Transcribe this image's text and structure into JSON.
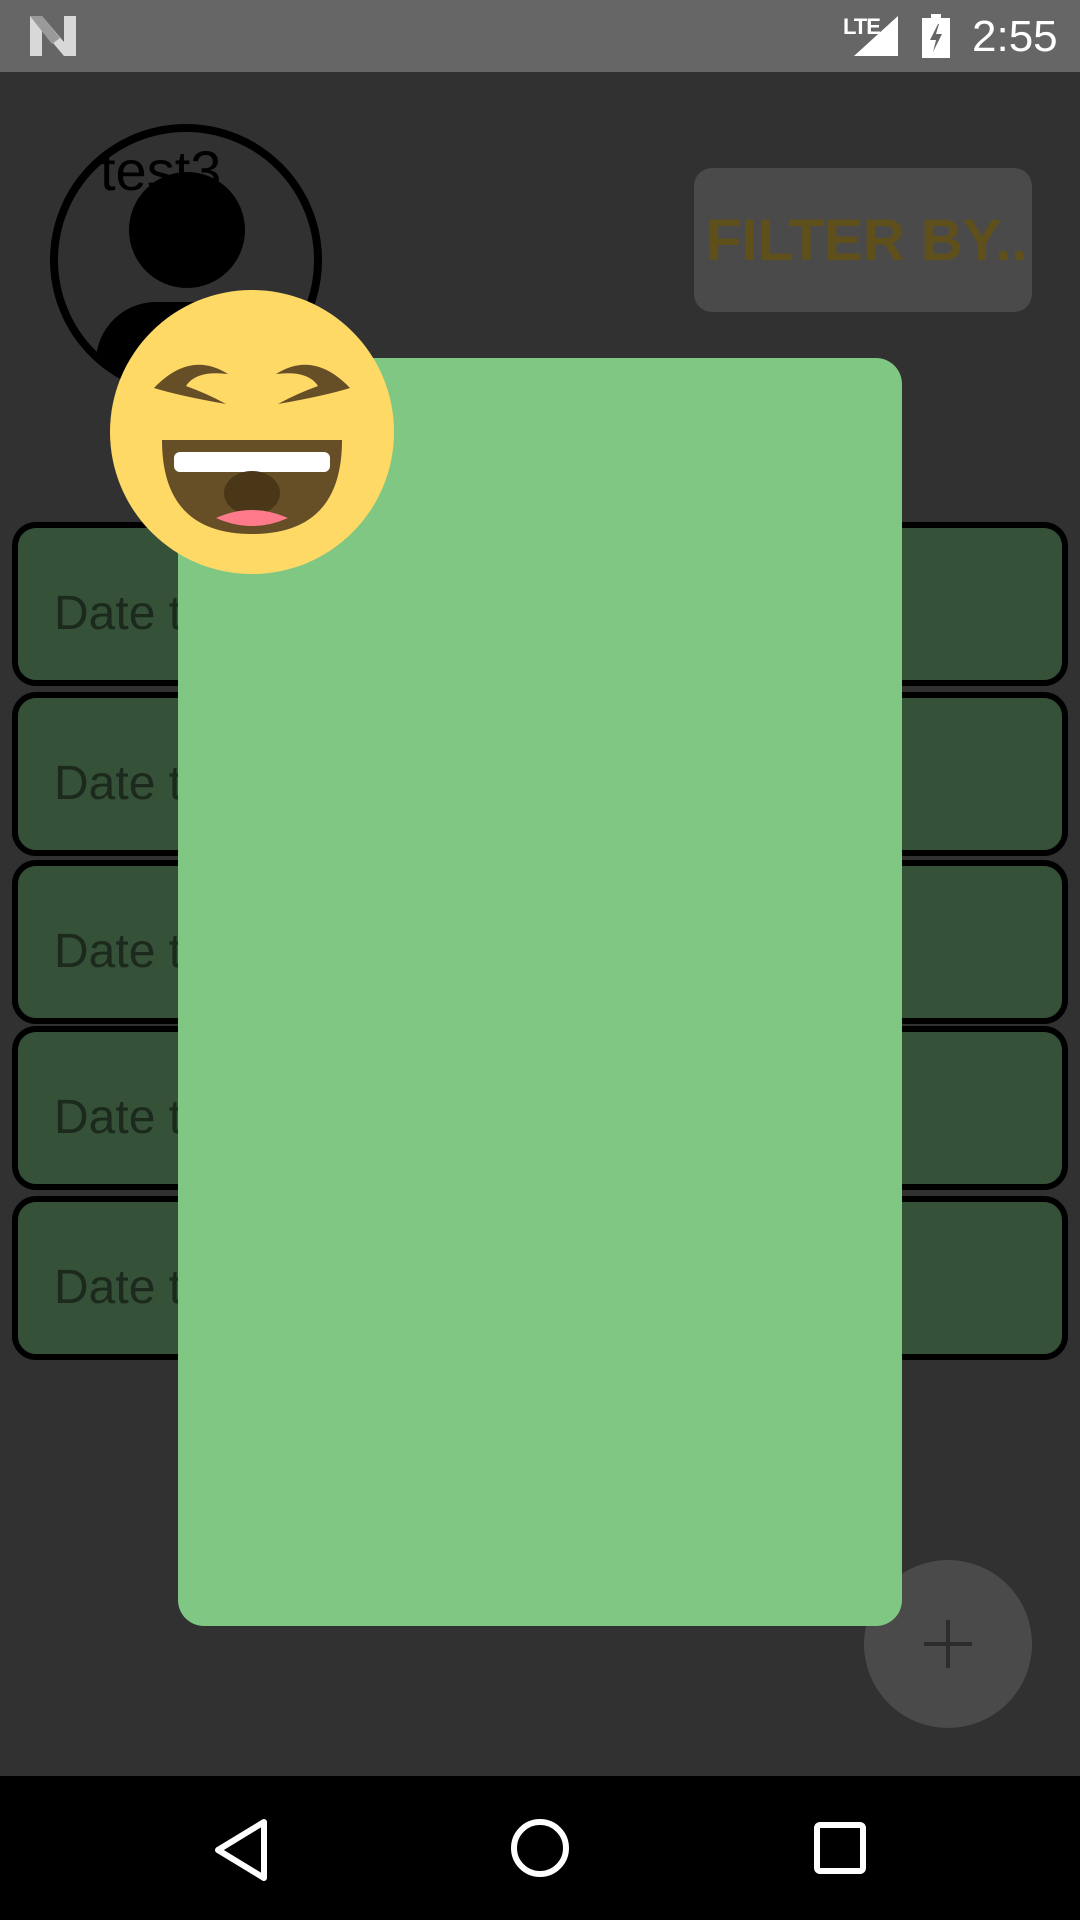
{
  "status_bar": {
    "network": "LTE",
    "time": "2:55",
    "icons": [
      "n-logo-icon",
      "signal-icon",
      "battery-charging-icon"
    ]
  },
  "profile": {
    "name": "test3",
    "avatar_icon": "person-icon"
  },
  "filter": {
    "label": "FILTER BY..."
  },
  "date_list": {
    "items": [
      {
        "label": "Date t",
        "right_text": ":"
      },
      {
        "label": "Date t",
        "right_text": ":"
      },
      {
        "label": "Date t",
        "right_text": ""
      },
      {
        "label": "Date t",
        "right_text": ""
      },
      {
        "label": "Date t",
        "right_text": ""
      }
    ]
  },
  "fab": {
    "icon": "plus-icon"
  },
  "dialog": {
    "emoji": "grinning-squinting-face-icon",
    "colors": {
      "background": "#81c784",
      "emoji_face": "#ffd966",
      "emoji_features": "#664e27"
    }
  },
  "nav_bar": {
    "icons": [
      "back-icon",
      "home-icon",
      "recents-icon"
    ]
  }
}
